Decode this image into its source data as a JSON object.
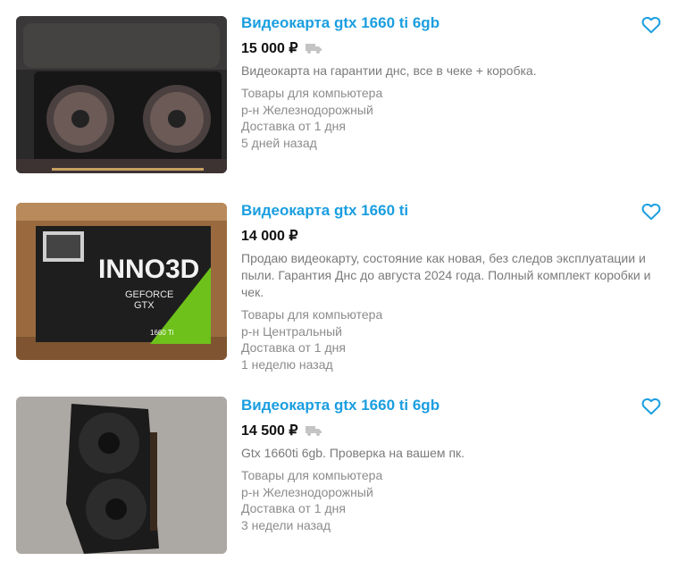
{
  "listings": [
    {
      "title": "Видеокарта gtx 1660 ti 6gb",
      "price": "15 000 ₽",
      "delivery_icon": "truck-icon",
      "description": "Видеокарта на гарантии днс, все в чеке + коробка.",
      "category": "Товары для компьютера",
      "district": "р-н Железнодорожный",
      "delivery": "Доставка от 1 дня",
      "posted": "5 дней назад"
    },
    {
      "title": "Видеокарта gtx 1660 ti",
      "price": "14 000 ₽",
      "description": "Продаю видеокарту, состояние как новая, без следов эксплуатации и пыли. Гарантия Днс до августа 2024 года. Полный комплект коробки и чек.",
      "category": "Товары для компьютера",
      "district": "р-н Центральный",
      "delivery": "Доставка от 1 дня",
      "posted": "1 неделю назад",
      "box_brand": "INNO3D",
      "box_line1": "GEFORCE",
      "box_line2": "GTX",
      "box_model": "1660 Ti"
    },
    {
      "title": "Видеокарта gtx 1660 ti 6gb",
      "price": "14 500 ₽",
      "delivery_icon": "truck-icon",
      "description": "Gtx 1660ti 6gb. Проверка на вашем пк.",
      "category": "Товары для компьютера",
      "district": "р-н Железнодорожный",
      "delivery": "Доставка от 1 дня",
      "posted": "3 недели назад"
    }
  ],
  "colors": {
    "title": "#1a9ee0",
    "heart": "#1a9ee0",
    "meta": "#8c8c8c"
  }
}
